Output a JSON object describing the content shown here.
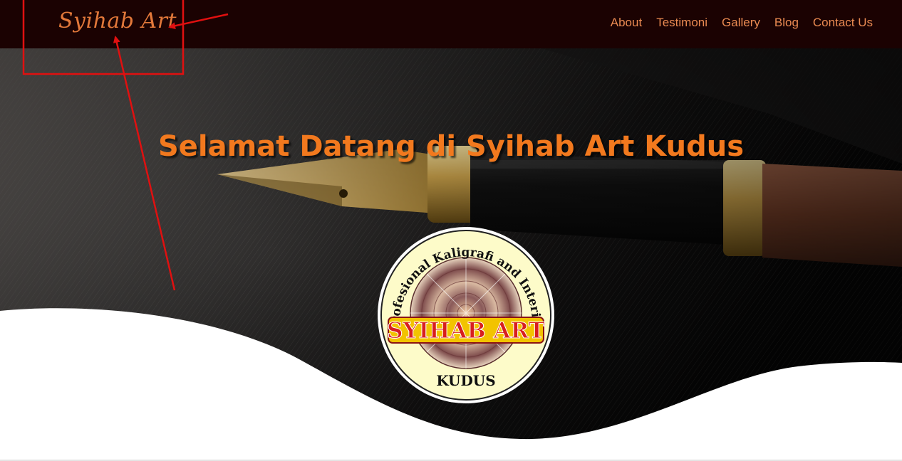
{
  "brand": {
    "name": "Syihab Art"
  },
  "nav": {
    "items": [
      {
        "label": "About"
      },
      {
        "label": "Testimoni"
      },
      {
        "label": "Gallery"
      },
      {
        "label": "Blog"
      },
      {
        "label": "Contact Us"
      }
    ]
  },
  "hero": {
    "title": "Selamat Datang di Syihab Art Kudus",
    "background": "pen-on-dark-fabric-image"
  },
  "badge": {
    "arc_text": "Profesional Kaligrafi and Interior",
    "name": "SYIHAB ART",
    "city": "KUDUS"
  },
  "colors": {
    "navbar_bg": "#1b0202",
    "brand": "#e2783a",
    "nav_link": "#ea8a52",
    "hero_title": "#f2791e",
    "annotation": "#e01010"
  }
}
